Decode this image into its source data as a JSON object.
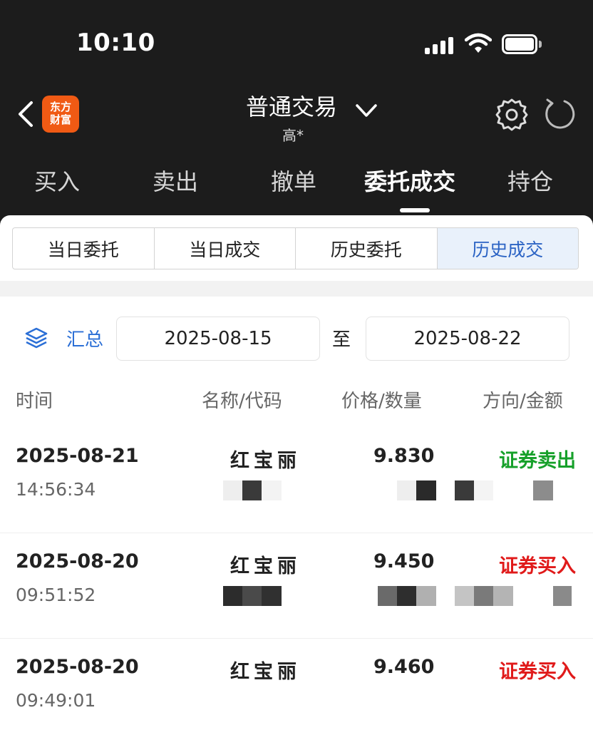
{
  "status": {
    "time": "10:10"
  },
  "header": {
    "logo_line1": "东方",
    "logo_line2": "财富",
    "title": "普通交易",
    "subtitle": "高*"
  },
  "main_tabs": [
    "买入",
    "卖出",
    "撤单",
    "委托成交",
    "持仓"
  ],
  "active_main_tab": "委托成交",
  "sub_tabs": [
    "当日委托",
    "当日成交",
    "历史委托",
    "历史成交"
  ],
  "active_sub_tab": "历史成交",
  "filter": {
    "summary": "汇总",
    "date_from": "2025-08-15",
    "to": "至",
    "date_to": "2025-08-22"
  },
  "columns": [
    "时间",
    "名称/代码",
    "价格/数量",
    "方向/金额"
  ],
  "rows": [
    {
      "date": "2025-08-21",
      "time": "14:56:34",
      "name": "红宝丽",
      "price": "9.830",
      "direction": "证券卖出"
    },
    {
      "date": "2025-08-20",
      "time": "09:51:52",
      "name": "红宝丽",
      "price": "9.450",
      "direction": "证券买入"
    },
    {
      "date": "2025-08-20",
      "time": "09:49:01",
      "name": "红宝丽",
      "price": "9.460",
      "direction": "证券买入"
    }
  ],
  "colors": {
    "sell": "#16a02a",
    "buy": "#e01a1a",
    "accent": "#2b6fd6",
    "brand": "#f05a14"
  }
}
